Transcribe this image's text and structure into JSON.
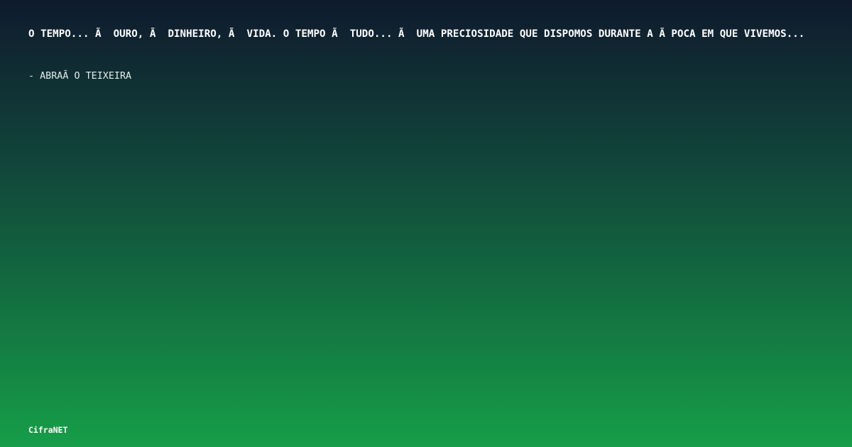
{
  "quote": {
    "text": "O TEMPO... Ã  OURO, Ã  DINHEIRO, Ã  VIDA. O TEMPO Ã  TUDO... Ã  UMA PRECIOSIDADE QUE DISPOMOS DURANTE A Ã POCA EM QUE VIVEMOS...",
    "author": "- ABRAÃ O TEIXEIRA"
  },
  "footer": {
    "brand": "CifraNET"
  }
}
